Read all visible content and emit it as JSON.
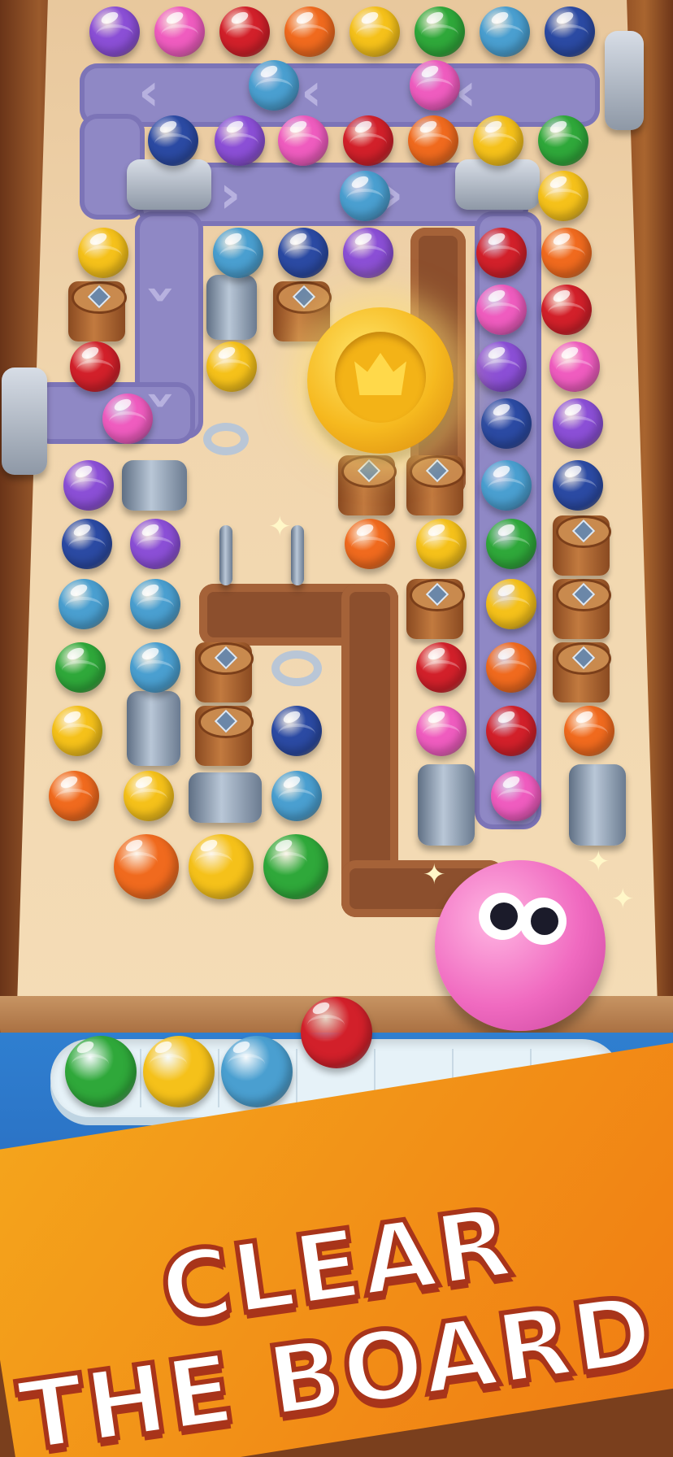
{
  "banner": {
    "line1": "CLEAR",
    "line2": "THE BOARD"
  },
  "colors": {
    "purple": "#8b4fd6",
    "pink": "#ef5cbf",
    "red": "#d2202a",
    "orange": "#f06a1e",
    "yellow": "#f5c11a",
    "green": "#2fa83a",
    "teal": "#4a9fd0",
    "blue": "#2b4aa3",
    "banner": "#f2901a",
    "tray": "#2f7fd0"
  },
  "top_row_marbles": [
    "purple",
    "pink",
    "red",
    "orange",
    "yellow",
    "green",
    "teal",
    "blue"
  ],
  "tray": {
    "slot_count": 8,
    "filled": [
      "green",
      "yellow",
      "teal"
    ],
    "incoming": "red"
  },
  "icons": [
    "coin-crown-icon",
    "pink-blob-character-icon",
    "barrel-icon",
    "pipe-icon",
    "gate-icon",
    "chevron-icon",
    "sparkle-icon"
  ]
}
